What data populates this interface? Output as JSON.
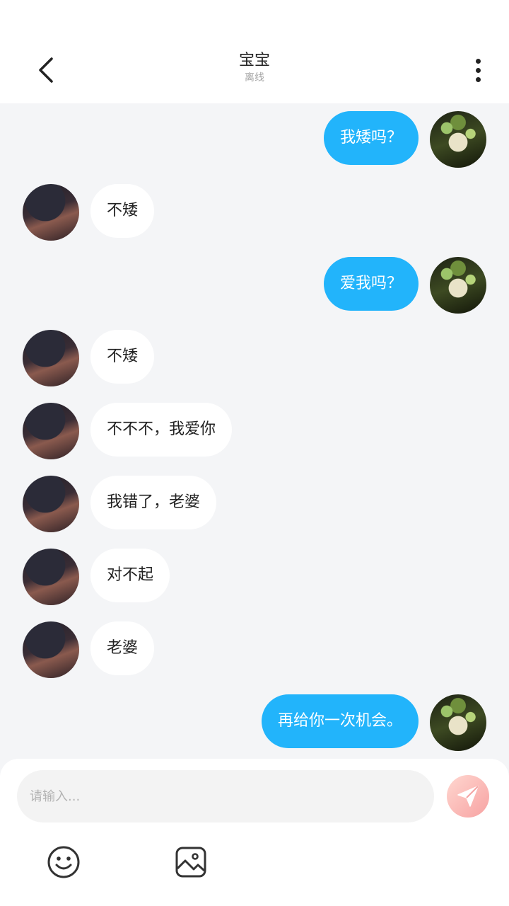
{
  "header": {
    "title": "宝宝",
    "status": "离线",
    "back_icon": "chevron-left-icon",
    "more_icon": "more-vertical-icon"
  },
  "messages": [
    {
      "from": "self",
      "text": "我矮吗？"
    },
    {
      "from": "other",
      "text": "不矮"
    },
    {
      "from": "self",
      "text": "爱我吗？"
    },
    {
      "from": "other",
      "text": "不矮"
    },
    {
      "from": "other",
      "text": "不不不，我爱你"
    },
    {
      "from": "other",
      "text": "我错了，老婆"
    },
    {
      "from": "other",
      "text": "对不起"
    },
    {
      "from": "other",
      "text": "老婆"
    },
    {
      "from": "self",
      "text": "再给你一次机会。"
    }
  ],
  "composer": {
    "placeholder": "请输入...",
    "send_icon": "send-icon",
    "tools": [
      "emoji-icon",
      "image-icon"
    ]
  },
  "colors": {
    "self_bubble": "#22b4fb",
    "other_bubble": "#ffffff",
    "background": "#f4f5f7",
    "send_button": "#f7a2a2"
  }
}
